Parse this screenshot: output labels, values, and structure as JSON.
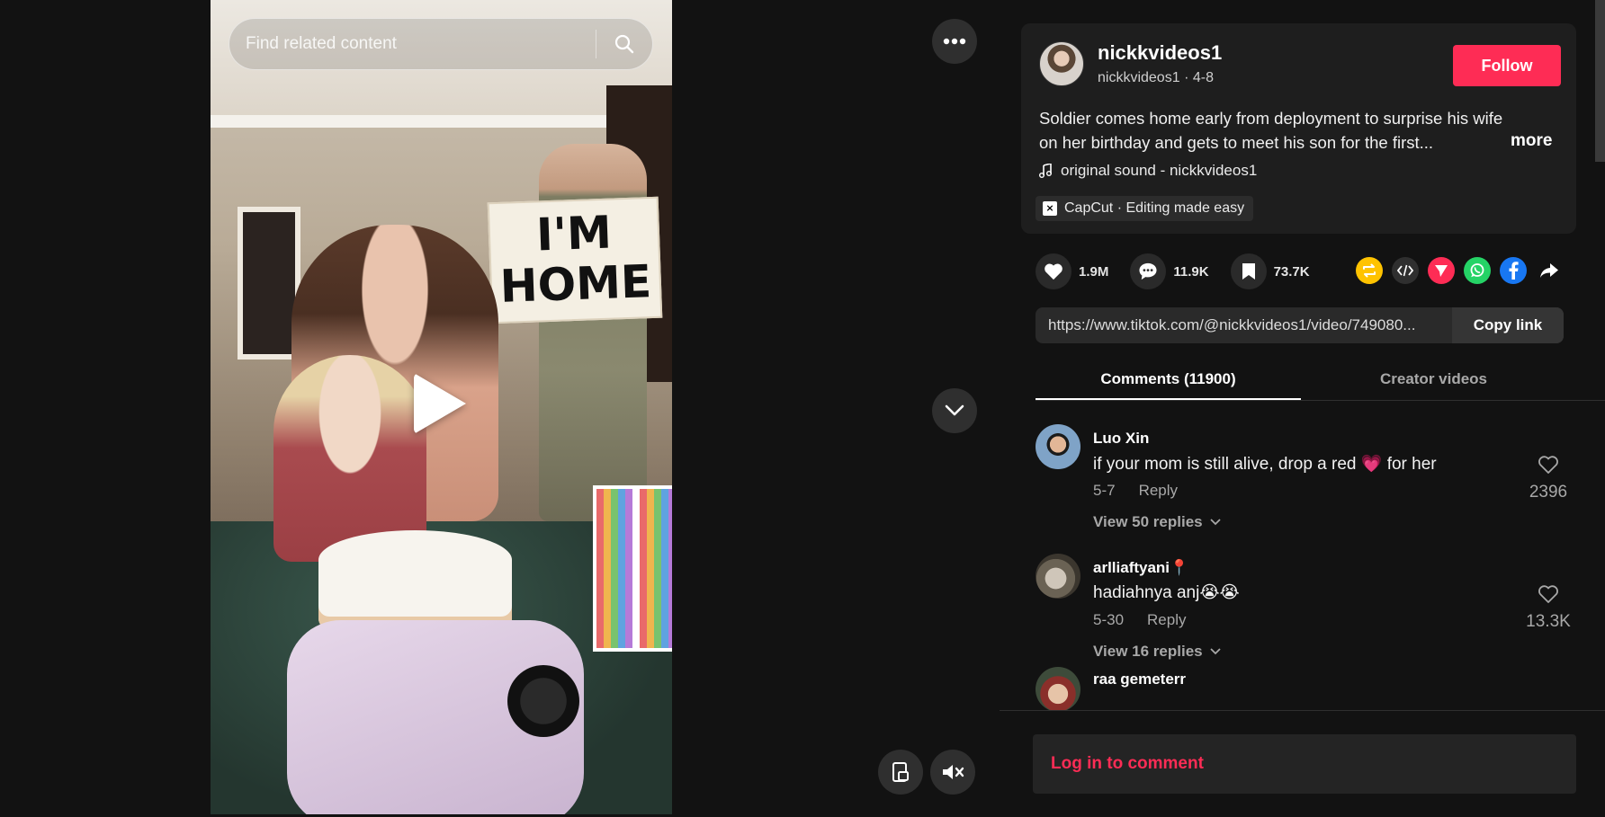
{
  "search": {
    "placeholder": "Find related content"
  },
  "video": {
    "sign_text_line1": "I'M",
    "sign_text_line2": "HOME"
  },
  "author": {
    "username": "nickkvideos1",
    "handle": "nickkvideos1",
    "date": "4-8",
    "follow_label": "Follow"
  },
  "description": {
    "line1": "Soldier comes home early from deployment to surprise his wife",
    "line2": "on her birthday and gets to meet his son for the first...",
    "more_label": "more"
  },
  "music": {
    "label": "original sound - nickkvideos1"
  },
  "capcut": {
    "label": "CapCut · Editing made easy"
  },
  "stats": {
    "likes": "1.9M",
    "comments": "11.9K",
    "saves": "73.7K"
  },
  "link": {
    "url": "https://www.tiktok.com/@nickkvideos1/video/749080...",
    "copy_label": "Copy link"
  },
  "tabs": [
    {
      "label": "Comments (11900)",
      "active": true
    },
    {
      "label": "Creator videos",
      "active": false
    }
  ],
  "comments": [
    {
      "user": "Luo Xin",
      "text_before": "if your mom is still alive, drop a red ",
      "emoji": "💗",
      "text_after": " for her",
      "date": "5-7",
      "reply_label": "Reply",
      "view_replies": "View 50 replies",
      "likes": "2396"
    },
    {
      "user": "arlliaftyani📍",
      "text_before": "hadiahnya anj😭😭",
      "emoji": "",
      "text_after": "",
      "date": "5-30",
      "reply_label": "Reply",
      "view_replies": "View 16 replies",
      "likes": "13.3K"
    },
    {
      "user": "raa gemeterr"
    }
  ],
  "login": {
    "label": "Log in to comment"
  },
  "colors": {
    "accent": "#fe2c55",
    "panel": "#1e1e1e",
    "background": "#121212"
  }
}
